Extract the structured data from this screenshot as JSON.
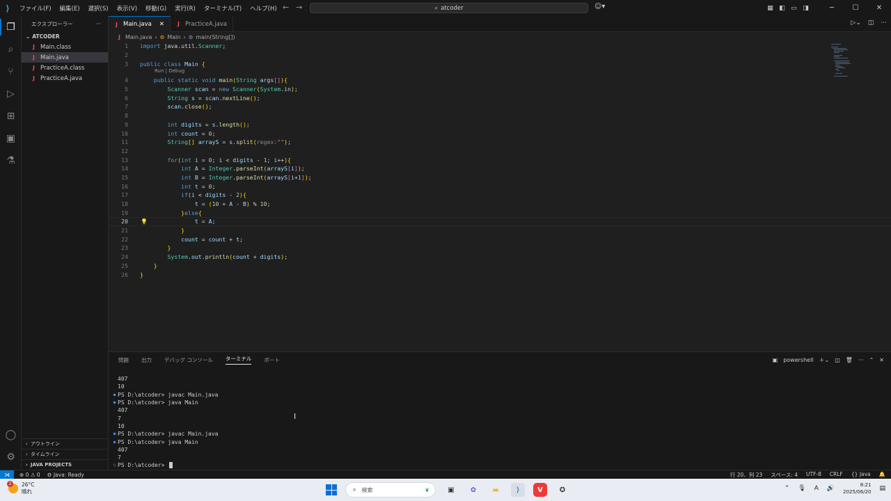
{
  "titlebar": {
    "menu": [
      "ファイル(F)",
      "編集(E)",
      "選択(S)",
      "表示(V)",
      "移動(G)",
      "実行(R)",
      "ターミナル(T)",
      "ヘルプ(H)"
    ],
    "search_text": "atcoder"
  },
  "sidebar": {
    "title": "エクスプローラー",
    "folder": "ATCODER",
    "files": [
      "Main.class",
      "Main.java",
      "PracticeA.class",
      "PracticeA.java"
    ],
    "sections": [
      "アウトライン",
      "タイムライン",
      "JAVA PROJECTS"
    ]
  },
  "tabs": [
    {
      "label": "Main.java",
      "active": true
    },
    {
      "label": "PracticeA.java",
      "active": false
    }
  ],
  "breadcrumbs": [
    "Main.java",
    "Main",
    "main(String[])"
  ],
  "codelens": "Run | Debug",
  "code_lines": [
    "import java.util.Scanner;",
    "",
    "public class Main {",
    "    public static void main(String args[]){",
    "        Scanner scan = new Scanner(System.in);",
    "        String s = scan.nextLine();",
    "        scan.close();",
    "",
    "        int digits = s.length();",
    "        int count = 0;",
    "        String[] arrayS = s.split(regex:\"\");",
    "",
    "        for(int i = 0; i < digits - 1; i++){",
    "            int A = Integer.parseInt(arrayS[i]);",
    "            int B = Integer.parseInt(arrayS[i+1]);",
    "            int t = 0;",
    "            if(i < digits - 2){",
    "                t = (10 + A - B) % 10;",
    "            }else{",
    "                t = A;",
    "            }",
    "            count = count + t;",
    "        }",
    "        System.out.println(count + digits);",
    "    }",
    "}"
  ],
  "current_line": 20,
  "panel": {
    "tabs": [
      "問題",
      "出力",
      "デバッグ コンソール",
      "ターミナル",
      "ポート"
    ],
    "active_tab": "ターミナル",
    "shell": "powershell",
    "terminal_lines": [
      {
        "dot": "",
        "text": "407"
      },
      {
        "dot": "",
        "text": "10"
      },
      {
        "dot": "blue",
        "text": "PS D:\\atcoder> javac Main.java"
      },
      {
        "dot": "blue",
        "text": "PS D:\\atcoder> java Main"
      },
      {
        "dot": "",
        "text": "407"
      },
      {
        "dot": "",
        "text": "7"
      },
      {
        "dot": "",
        "text": "10"
      },
      {
        "dot": "blue",
        "text": "PS D:\\atcoder> javac Main.java"
      },
      {
        "dot": "blue",
        "text": "PS D:\\atcoder> java Main"
      },
      {
        "dot": "",
        "text": "407"
      },
      {
        "dot": "",
        "text": "7"
      },
      {
        "dot": "empty",
        "text": "PS D:\\atcoder> "
      }
    ]
  },
  "statusbar": {
    "problems": "0 ⚠ 0",
    "java_status": "Java: Ready",
    "position": "行 20、列 23",
    "spaces": "スペース: 4",
    "encoding": "UTF-8",
    "eol": "CRLF",
    "language": "Java"
  },
  "taskbar": {
    "temperature": "26°C",
    "weather": "晴れ",
    "weather_badge": "2",
    "search_placeholder": "検索",
    "time": "8:21",
    "date": "2025/06/20"
  }
}
